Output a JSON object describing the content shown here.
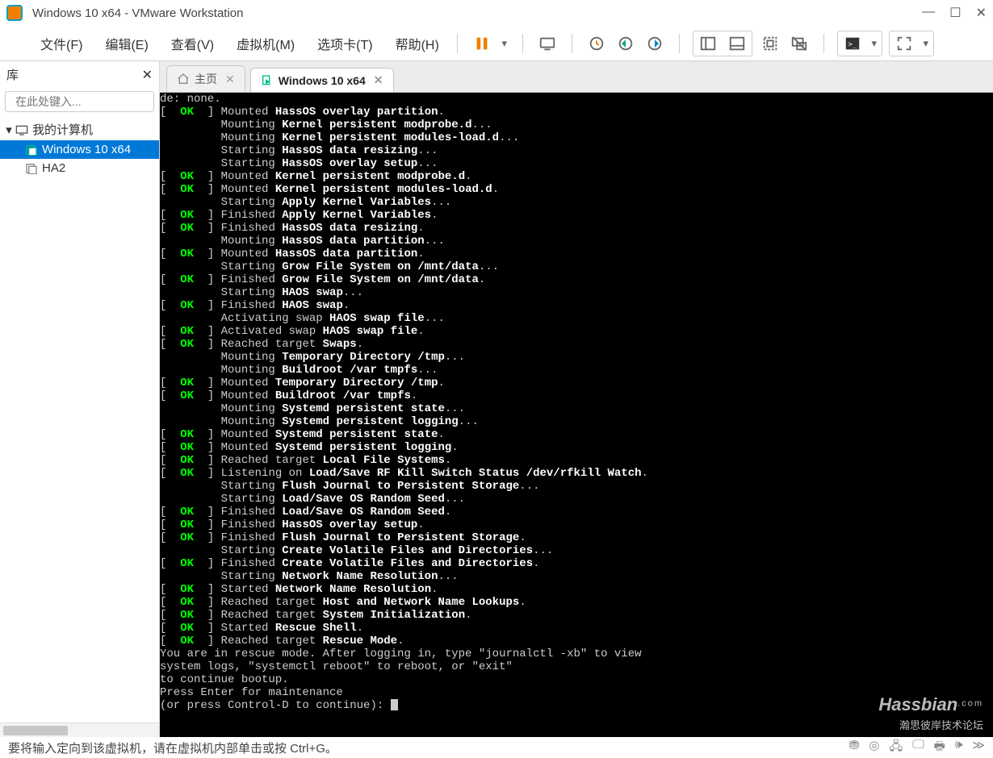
{
  "title": "Windows 10 x64 - VMware Workstation",
  "menu": [
    "文件(F)",
    "编辑(E)",
    "查看(V)",
    "虚拟机(M)",
    "选项卡(T)",
    "帮助(H)"
  ],
  "sidebar": {
    "heading": "库",
    "placeholder": "在此处键入...",
    "root": "我的计算机",
    "items": [
      "Windows 10 x64",
      "HA2"
    ],
    "selected": 0
  },
  "tabs": [
    {
      "label": "主页",
      "active": false,
      "home": true
    },
    {
      "label": "Windows 10 x64",
      "active": true,
      "home": false
    }
  ],
  "status": "要将输入定向到该虚拟机，请在虚拟机内部单击或按 Ctrl+G。",
  "watermark": {
    "brand": "Hassbian",
    "tld": ".com",
    "han": "瀚思彼岸技术论坛"
  },
  "console": {
    "pre": "de: none.",
    "lines": [
      {
        "ok": true,
        "verb": "Mounted",
        "msg": "HassOS overlay partition",
        "end": "."
      },
      {
        "ok": false,
        "verb": "Mounting",
        "msg": "Kernel persistent modprobe.d",
        "end": "..."
      },
      {
        "ok": false,
        "verb": "Mounting",
        "msg": "Kernel persistent modules-load.d",
        "end": "..."
      },
      {
        "ok": false,
        "verb": "Starting",
        "msg": "HassOS data resizing",
        "end": "..."
      },
      {
        "ok": false,
        "verb": "Starting",
        "msg": "HassOS overlay setup",
        "end": "..."
      },
      {
        "ok": true,
        "verb": "Mounted",
        "msg": "Kernel persistent modprobe.d",
        "end": "."
      },
      {
        "ok": true,
        "verb": "Mounted",
        "msg": "Kernel persistent modules-load.d",
        "end": "."
      },
      {
        "ok": false,
        "verb": "Starting",
        "msg": "Apply Kernel Variables",
        "end": "..."
      },
      {
        "ok": true,
        "verb": "Finished",
        "msg": "Apply Kernel Variables",
        "end": "."
      },
      {
        "ok": true,
        "verb": "Finished",
        "msg": "HassOS data resizing",
        "end": "."
      },
      {
        "ok": false,
        "verb": "Mounting",
        "msg": "HassOS data partition",
        "end": "..."
      },
      {
        "ok": true,
        "verb": "Mounted",
        "msg": "HassOS data partition",
        "end": "."
      },
      {
        "ok": false,
        "verb": "Starting",
        "msg": "Grow File System on /mnt/data",
        "end": "..."
      },
      {
        "ok": true,
        "verb": "Finished",
        "msg": "Grow File System on /mnt/data",
        "end": "."
      },
      {
        "ok": false,
        "verb": "Starting",
        "msg": "HAOS swap",
        "end": "..."
      },
      {
        "ok": true,
        "verb": "Finished",
        "msg": "HAOS swap",
        "end": "."
      },
      {
        "ok": false,
        "verb": "Activating swap",
        "msg": "HAOS swap file",
        "end": "..."
      },
      {
        "ok": true,
        "verb": "Activated swap",
        "msg": "HAOS swap file",
        "end": "."
      },
      {
        "ok": true,
        "verb": "Reached target",
        "msg": "Swaps",
        "end": "."
      },
      {
        "ok": false,
        "verb": "Mounting",
        "msg": "Temporary Directory /tmp",
        "end": "..."
      },
      {
        "ok": false,
        "verb": "Mounting",
        "msg": "Buildroot /var tmpfs",
        "end": "..."
      },
      {
        "ok": true,
        "verb": "Mounted",
        "msg": "Temporary Directory /tmp",
        "end": "."
      },
      {
        "ok": true,
        "verb": "Mounted",
        "msg": "Buildroot /var tmpfs",
        "end": "."
      },
      {
        "ok": false,
        "verb": "Mounting",
        "msg": "Systemd persistent state",
        "end": "..."
      },
      {
        "ok": false,
        "verb": "Mounting",
        "msg": "Systemd persistent logging",
        "end": "..."
      },
      {
        "ok": true,
        "verb": "Mounted",
        "msg": "Systemd persistent state",
        "end": "."
      },
      {
        "ok": true,
        "verb": "Mounted",
        "msg": "Systemd persistent logging",
        "end": "."
      },
      {
        "ok": true,
        "verb": "Reached target",
        "msg": "Local File Systems",
        "end": "."
      },
      {
        "ok": true,
        "verb": "Listening on",
        "msg": "Load/Save RF Kill Switch Status /dev/rfkill Watch",
        "end": "."
      },
      {
        "ok": false,
        "verb": "Starting",
        "msg": "Flush Journal to Persistent Storage",
        "end": "..."
      },
      {
        "ok": false,
        "verb": "Starting",
        "msg": "Load/Save OS Random Seed",
        "end": "..."
      },
      {
        "ok": true,
        "verb": "Finished",
        "msg": "Load/Save OS Random Seed",
        "end": "."
      },
      {
        "ok": true,
        "verb": "Finished",
        "msg": "HassOS overlay setup",
        "end": "."
      },
      {
        "ok": true,
        "verb": "Finished",
        "msg": "Flush Journal to Persistent Storage",
        "end": "."
      },
      {
        "ok": false,
        "verb": "Starting",
        "msg": "Create Volatile Files and Directories",
        "end": "..."
      },
      {
        "ok": true,
        "verb": "Finished",
        "msg": "Create Volatile Files and Directories",
        "end": "."
      },
      {
        "ok": false,
        "verb": "Starting",
        "msg": "Network Name Resolution",
        "end": "..."
      },
      {
        "ok": true,
        "verb": "Started",
        "msg": "Network Name Resolution",
        "end": "."
      },
      {
        "ok": true,
        "verb": "Reached target",
        "msg": "Host and Network Name Lookups",
        "end": "."
      },
      {
        "ok": true,
        "verb": "Reached target",
        "msg": "System Initialization",
        "end": "."
      },
      {
        "ok": true,
        "verb": "Started",
        "msg": "Rescue Shell",
        "end": "."
      },
      {
        "ok": true,
        "verb": "Reached target",
        "msg": "Rescue Mode",
        "end": "."
      }
    ],
    "post": [
      "You are in rescue mode. After logging in, type \"journalctl -xb\" to view",
      "system logs, \"systemctl reboot\" to reboot, or \"exit\"",
      "to continue bootup.",
      "Press Enter for maintenance",
      "(or press Control-D to continue): "
    ]
  }
}
